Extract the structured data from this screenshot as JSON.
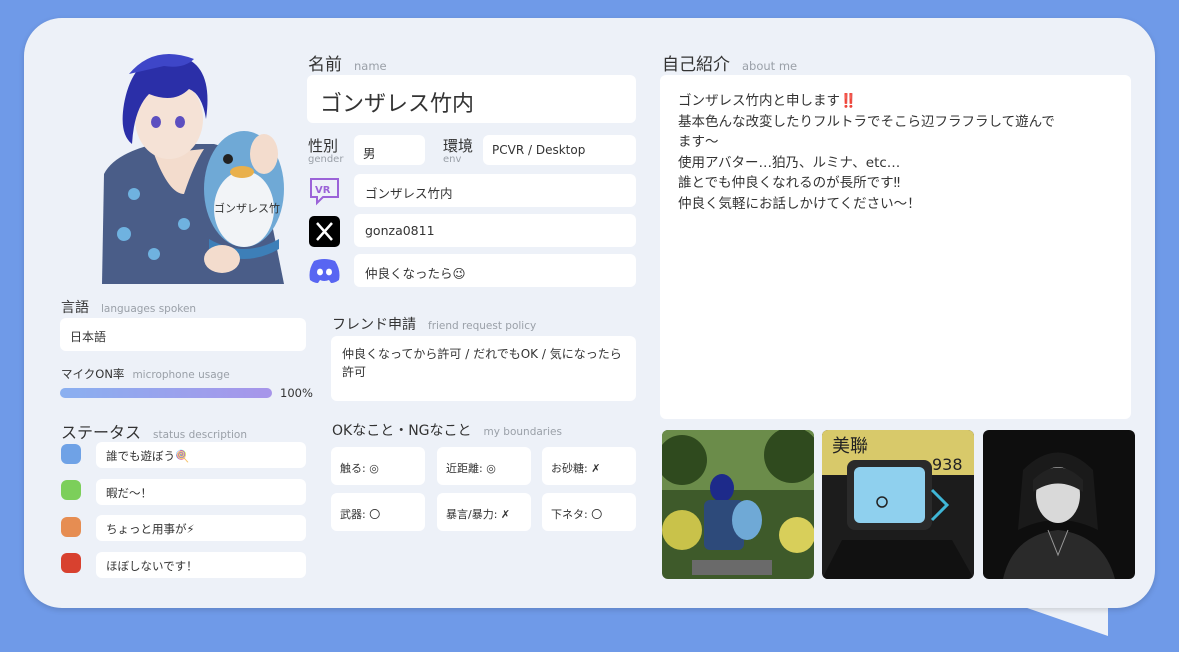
{
  "name": {
    "label": "名前",
    "sub": "name",
    "value": "ゴンザレス竹内"
  },
  "gender": {
    "label": "性別",
    "sub": "gender",
    "value": "男"
  },
  "env": {
    "label": "環境",
    "sub": "env",
    "value": "PCVR / Desktop"
  },
  "accounts": {
    "vrchat": "ゴンザレス竹内",
    "x": "gonza0811",
    "discord": "仲良くなったら😉"
  },
  "languages": {
    "label": "言語",
    "sub": "languages spoken",
    "value": "日本語"
  },
  "mic": {
    "label": "マイクON率",
    "sub": "microphone usage",
    "percent_text": "100%",
    "percent": 1.0
  },
  "status": {
    "label": "ステータス",
    "sub": "status description",
    "items": [
      {
        "text": "誰でも遊ぼう🍭",
        "color": "#6fa2e6"
      },
      {
        "text": "暇だ〜！",
        "color": "#7ccf5a"
      },
      {
        "text": "ちょっと用事が⚡",
        "color": "#e68d52"
      },
      {
        "text": "ほぼしないです！",
        "color": "#d8412f"
      }
    ]
  },
  "friend": {
    "label": "フレンド申請",
    "sub": "friend request policy",
    "value": "仲良くなってから許可 / だれでもOK / 気になったら許可"
  },
  "boundaries": {
    "label": "OKなこと・NGなこと",
    "sub": "my boundaries",
    "items": [
      "触る: ◎",
      "近距離: ◎",
      "お砂糖: ✗",
      "武器: 〇",
      "暴言/暴力: ✗",
      "下ネタ: 〇"
    ]
  },
  "about": {
    "label": "自己紹介",
    "sub": "about me",
    "lines": [
      "ゴンザレス竹内と申します‼️",
      "基本色んな改変したりフルトラでそこら辺フラフラして遊んで",
      "ます〜",
      "使用アバター…狛乃、ルミナ、etc…",
      "誰とでも仲良くなれるのが長所です‼",
      "仲良く気軽にお話しかけてください〜！"
    ]
  },
  "colors": {
    "background": "#6f9ae8",
    "card": "#edf1f8",
    "mic_bar": "#9aa8ee"
  },
  "icons": [
    "vrchat-icon",
    "x-logo-icon",
    "discord-icon"
  ]
}
